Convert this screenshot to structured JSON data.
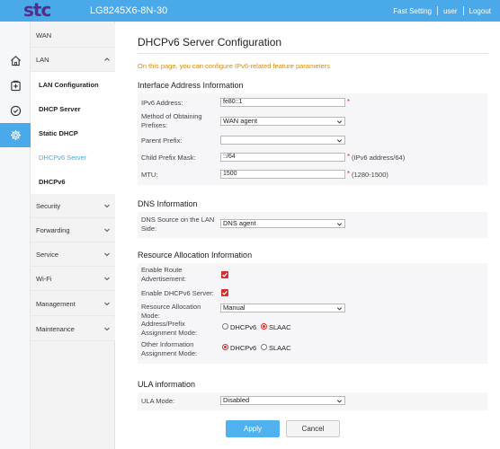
{
  "header": {
    "logo": "stc",
    "model": "LG8245X6-8N-30",
    "links": [
      "Fast Setting",
      "user",
      "Logout"
    ]
  },
  "icon_rail": [
    "home-icon",
    "plus-box-icon",
    "check-circle-icon",
    "gear-icon"
  ],
  "menu": {
    "wan": "WAN",
    "lan": "LAN",
    "lan_items": [
      "LAN Configuration",
      "DHCP Server",
      "Static DHCP",
      "DHCPv6 Server",
      "DHCPv6"
    ],
    "security": "Security",
    "forwarding": "Forwarding",
    "service": "Service",
    "wifi": "Wi-Fi",
    "management": "Management",
    "maintenance": "Maintenance"
  },
  "page": {
    "title": "DHCPv6 Server Configuration",
    "note": "On this page, you can configure IPv6-related feature parameters"
  },
  "interface": {
    "title": "Interface Address Information",
    "ipv6_label": "IPv6 Address:",
    "ipv6_value": "fe80::1",
    "method_label_1": "Method of Obtaining",
    "method_label_2": "Prefixes:",
    "method_value": "WAN agent",
    "parent_label": "Parent Prefix:",
    "parent_value": "",
    "child_label": "Child Prefix Mask:",
    "child_value": "::/64",
    "child_hint": "(IPv6 address/64)",
    "mtu_label": "MTU:",
    "mtu_value": "1500",
    "mtu_hint": "(1280-1500)",
    "required_mark": "*"
  },
  "dns": {
    "title": "DNS Information",
    "source_label_1": "DNS Source on the LAN",
    "source_label_2": "Side:",
    "source_value": "DNS agent"
  },
  "resource": {
    "title": "Resource Allocation Information",
    "route_label_1": "Enable Route",
    "route_label_2": "Advertisement:",
    "route_checked": true,
    "dhcpv6_label": "Enable DHCPv6 Server:",
    "dhcpv6_checked": true,
    "mode_label_1": "Resource Allocation",
    "mode_label_2": "Mode:",
    "mode_value": "Manual",
    "addr_label_1": "Address/Prefix",
    "addr_label_2": "Assignment Mode:",
    "addr_options": [
      "DHCPv6",
      "SLAAC"
    ],
    "addr_selected": "SLAAC",
    "other_label_1": "Other Information",
    "other_label_2": "Assignment Mode:",
    "other_options": [
      "DHCPv6",
      "SLAAC"
    ],
    "other_selected": "DHCPv6"
  },
  "ula": {
    "title": "ULA information",
    "mode_label": "ULA Mode:",
    "mode_value": "Disabled"
  },
  "buttons": {
    "apply": "Apply",
    "cancel": "Cancel"
  },
  "colors": {
    "accent": "#4aa9e9",
    "note": "#e08a00",
    "required": "#e03030",
    "checkbox": "#d32f2f"
  }
}
